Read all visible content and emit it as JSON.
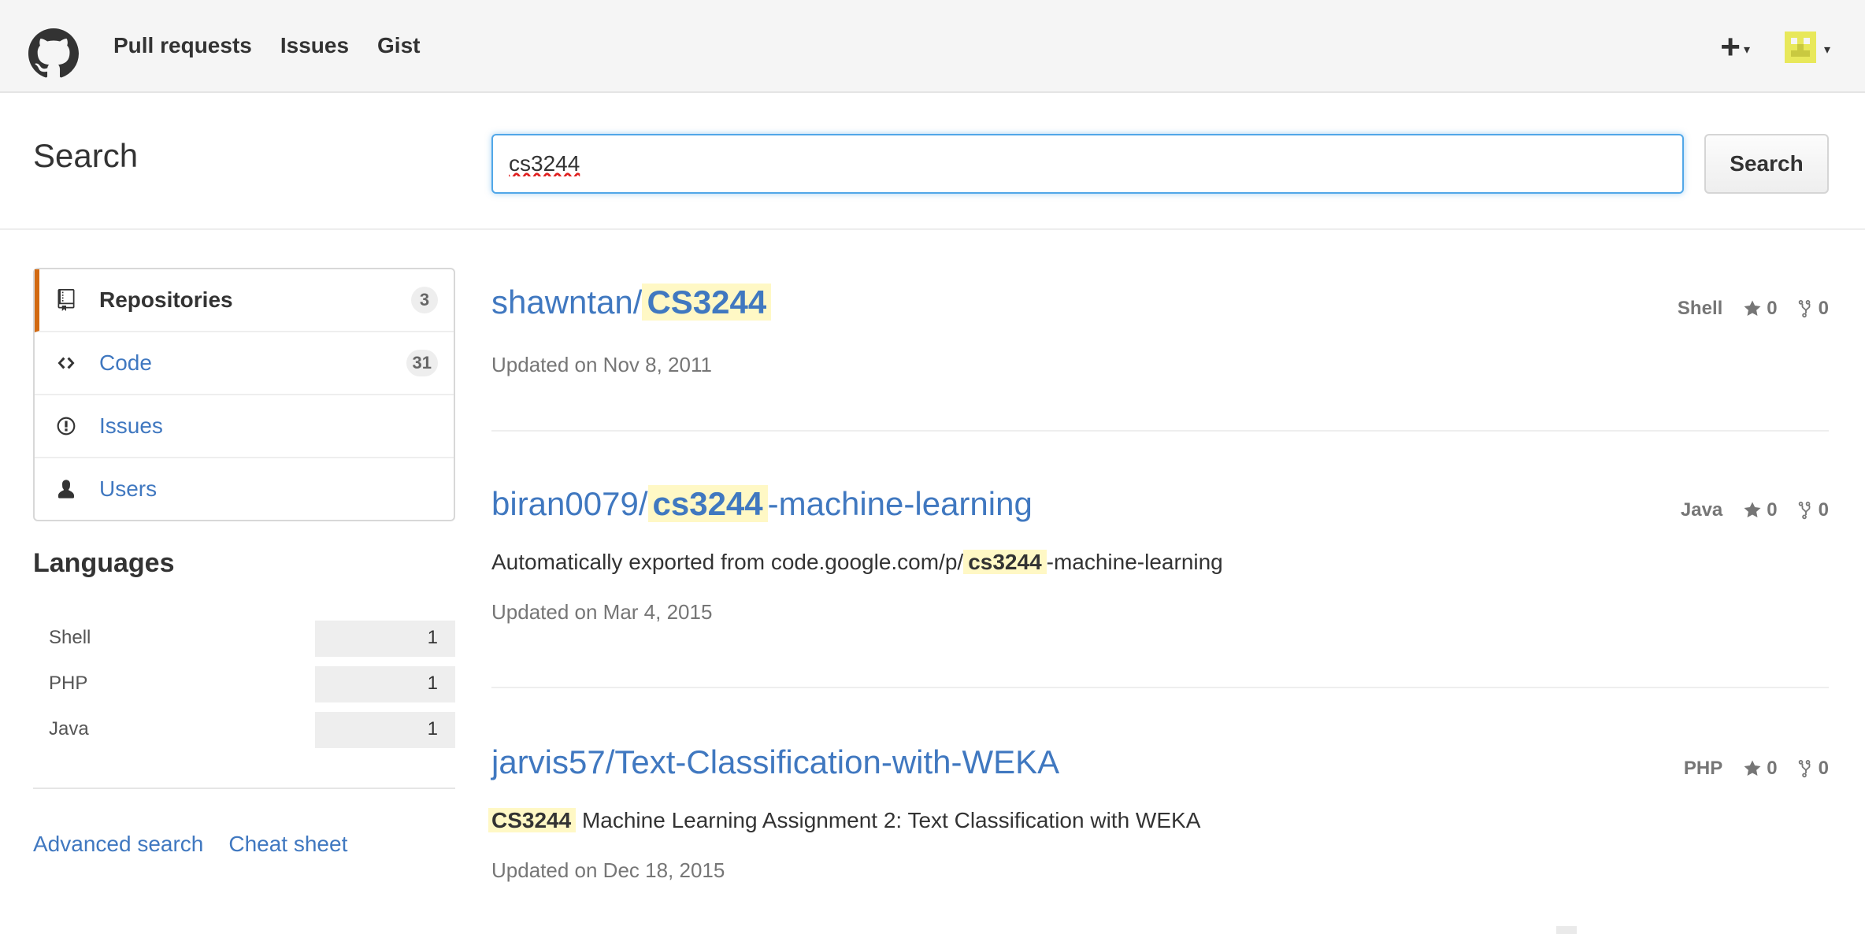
{
  "nav": {
    "links": [
      "Pull requests",
      "Issues",
      "Gist"
    ],
    "icons": [
      "github-logo-icon",
      "plus-icon",
      "avatar-icon"
    ],
    "plus_label": "+"
  },
  "search": {
    "title": "Search",
    "query": "cs3244",
    "button_label": "Search"
  },
  "sidebar": {
    "filters": [
      {
        "label": "Repositories",
        "count": "3",
        "icon": "repo-icon",
        "selected": true
      },
      {
        "label": "Code",
        "count": "31",
        "icon": "code-icon",
        "selected": false
      },
      {
        "label": "Issues",
        "icon": "issue-icon",
        "selected": false
      },
      {
        "label": "Users",
        "icon": "person-icon",
        "selected": false
      }
    ],
    "languages_title": "Languages",
    "languages": [
      {
        "name": "Shell",
        "count": "1"
      },
      {
        "name": "PHP",
        "count": "1"
      },
      {
        "name": "Java",
        "count": "1"
      }
    ],
    "links": [
      "Advanced search",
      "Cheat sheet"
    ]
  },
  "results": [
    {
      "owner_prefix": "shawntan/",
      "highlight": "CS3244",
      "name_suffix": "",
      "description_prefix": "",
      "description_highlight": "",
      "description_suffix": "",
      "updated": "Updated on Nov 8, 2011",
      "language": "Shell",
      "stars": "0",
      "forks": "0"
    },
    {
      "owner_prefix": "biran0079/",
      "highlight": "cs3244",
      "name_suffix": "-machine-learning",
      "description_prefix": "Automatically exported from code.google.com/p/",
      "description_highlight": "cs3244",
      "description_suffix": "-machine-learning",
      "updated": "Updated on Mar 4, 2015",
      "language": "Java",
      "stars": "0",
      "forks": "0"
    },
    {
      "owner_prefix": "jarvis57/Text-Classification-with-WEKA",
      "highlight": "",
      "name_suffix": "",
      "description_prefix": "",
      "description_highlight": "CS3244",
      "description_suffix": " Machine Learning Assignment 2: Text Classification with WEKA",
      "updated": "Updated on Dec 18, 2015",
      "language": "PHP",
      "stars": "0",
      "forks": "0"
    }
  ],
  "colors": {
    "link": "#4078c0",
    "highlight": "#fff8c5",
    "selected_accent": "#d26911",
    "focus_border": "#51a7e8"
  }
}
